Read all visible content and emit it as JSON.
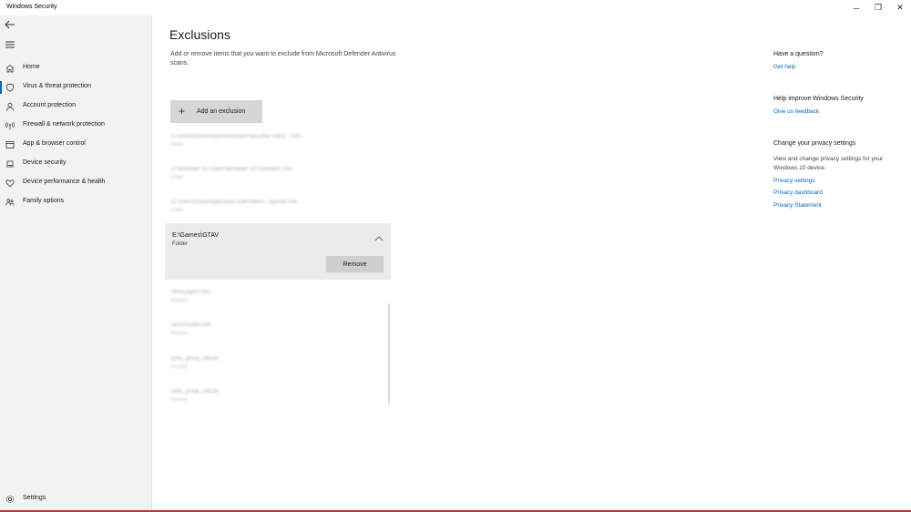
{
  "window": {
    "title": "Windows Security",
    "controls": {
      "minimize": "─",
      "restore": "❐",
      "close": "✕"
    }
  },
  "sidebar": {
    "items": [
      {
        "label": "Home",
        "icon": "home-icon",
        "active": false
      },
      {
        "label": "Virus & threat protection",
        "icon": "shield-icon",
        "active": true
      },
      {
        "label": "Account protection",
        "icon": "person-icon",
        "active": false
      },
      {
        "label": "Firewall & network protection",
        "icon": "antenna-icon",
        "active": false
      },
      {
        "label": "App & browser control",
        "icon": "browser-window-icon",
        "active": false
      },
      {
        "label": "Device security",
        "icon": "laptop-icon",
        "active": false
      },
      {
        "label": "Device performance & health",
        "icon": "heart-icon",
        "active": false
      },
      {
        "label": "Family options",
        "icon": "family-icon",
        "active": false
      }
    ],
    "settings_label": "Settings"
  },
  "main": {
    "title": "Exclusions",
    "description": "Add or remove items that you want to exclude from Microsoft Defender Antivirus scans.",
    "add_button_label": "Add an exclusion",
    "blurred_items_before": [
      {
        "path": "C:\\Users\\David\\AppData\\Roaming\\Lunar Client - Sett...",
        "type": "Folder"
      },
      {
        "path": "D:\\Windows 11 Folder\\Windows 10 Activation Tool",
        "type": "Folder"
      },
      {
        "path": "C:\\Users\\David\\AppData\\Local\\Roblox - Special Gift...",
        "type": "Folder"
      }
    ],
    "expanded_item": {
      "path": "E:\\Games\\GTAV",
      "type": "Folder",
      "remove_label": "Remove"
    },
    "blurred_items_after": [
      {
        "path": "libraryagent.exe",
        "type": "Process"
      },
      {
        "path": "launchsetter.exe",
        "type": "Process"
      },
      {
        "path": "polls_group_official",
        "type": "Process"
      },
      {
        "path": "polls_group_official",
        "type": "Process"
      }
    ]
  },
  "right_panel": {
    "question_heading": "Have a question?",
    "get_help_link": "Get help",
    "improve_heading": "Help improve Windows Security",
    "feedback_link": "Give us feedback",
    "privacy_heading": "Change your privacy settings",
    "privacy_text": "View and change privacy settings for your Windows 10 device.",
    "privacy_links": [
      "Privacy settings",
      "Privacy dashboard",
      "Privacy Statement"
    ]
  },
  "colors": {
    "accent": "#0067c0",
    "sidebar_bg": "#f2f2f2",
    "button_bg": "#d6d6d6",
    "expanded_bg": "#ebebeb"
  }
}
